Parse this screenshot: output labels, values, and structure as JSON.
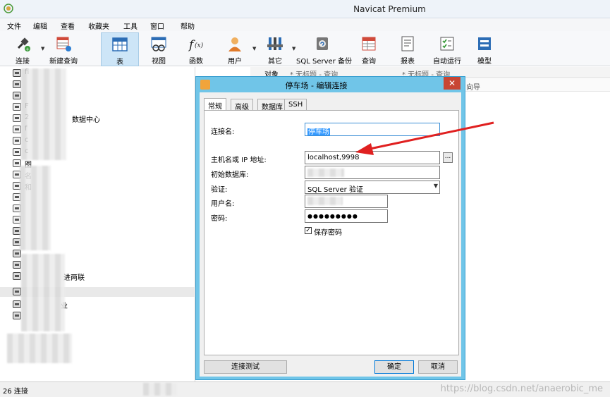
{
  "window": {
    "title": "Navicat Premium"
  },
  "menu": [
    "文件",
    "编辑",
    "查看",
    "收藏夹",
    "工具",
    "窗口",
    "帮助"
  ],
  "toolbar": {
    "connect": "连接",
    "new_query": "新建查询",
    "table": "表",
    "view": "视图",
    "function": "函数",
    "user": "用户",
    "other": "其它",
    "sql_backup": "SQL Server 备份",
    "query": "查询",
    "report": "报表",
    "automation": "自动运行",
    "model": "模型"
  },
  "nav": {
    "items": [
      {
        "label": "fi"
      },
      {
        "label": ""
      },
      {
        "label": ""
      },
      {
        "label": "F"
      },
      {
        "label": "2",
        "suffix": "数据中心"
      },
      {
        "label": "f"
      },
      {
        "label": "c"
      },
      {
        "label": "c"
      },
      {
        "label": "图"
      },
      {
        "label": "名"
      },
      {
        "label": "和"
      },
      {
        "label": ""
      },
      {
        "label": ""
      },
      {
        "label": ""
      },
      {
        "label": ""
      },
      {
        "label": ""
      },
      {
        "label": ""
      },
      {
        "label": ""
      },
      {
        "label": ""
      },
      {
        "label": "",
        "suffix": "进两联"
      },
      {
        "label": ""
      },
      {
        "label": ""
      },
      {
        "label": ""
      },
      {
        "label": "",
        "suffix": "业"
      }
    ]
  },
  "object_tabs": {
    "objects": "对象",
    "untitled_query_1": "* 无标题 - 查询",
    "untitled_query_2": "* 无标题 - 查询",
    "wizard": "向导"
  },
  "dialog": {
    "title": "停车场 - 编辑连接",
    "tabs": [
      "常规",
      "高级",
      "数据库",
      "SSH"
    ],
    "fields": {
      "connection_name_label": "连接名:",
      "connection_name_value": "停车场",
      "host_label": "主机名或 IP 地址:",
      "host_value": "localhost,9998",
      "initial_db_label": "初始数据库:",
      "initial_db_value": "",
      "auth_label": "验证:",
      "auth_value": "SQL Server 验证",
      "username_label": "用户名:",
      "username_value": "",
      "password_label": "密码:",
      "password_value": "●●●●●●●●●",
      "save_password_label": "保存密码",
      "save_password_checked": true
    },
    "buttons": {
      "test": "连接测试",
      "ok": "确定",
      "cancel": "取消",
      "ellipsis": "..."
    }
  },
  "status": {
    "connections": "26 连接"
  },
  "watermark": "https://blog.csdn.net/anaerobic_me",
  "colors": {
    "dialog_border": "#70c5e8",
    "annotation_arrow": "#e02020",
    "selected_tool": "#cde5f7"
  }
}
